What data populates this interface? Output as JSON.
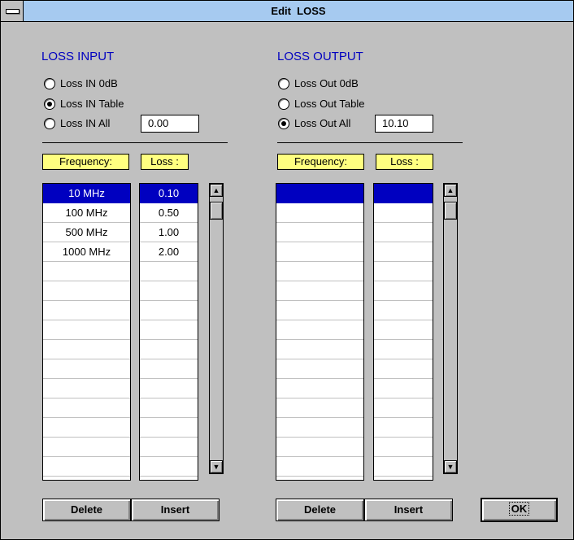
{
  "window": {
    "title": "Edit  LOSS"
  },
  "input": {
    "section_title": "LOSS INPUT",
    "radios": [
      {
        "label": "Loss IN 0dB",
        "checked": false
      },
      {
        "label": "Loss IN Table",
        "checked": true
      },
      {
        "label": "Loss IN All",
        "checked": false
      }
    ],
    "all_value": "0.00",
    "freq_header": "Frequency:",
    "loss_header": "Loss :",
    "rows": [
      {
        "freq": "10 MHz",
        "loss": "0.10",
        "selected": true
      },
      {
        "freq": "100 MHz",
        "loss": "0.50",
        "selected": false
      },
      {
        "freq": "500 MHz",
        "loss": "1.00",
        "selected": false
      },
      {
        "freq": "1000 MHz",
        "loss": "2.00",
        "selected": false
      }
    ],
    "delete_label": "Delete",
    "insert_label": "Insert"
  },
  "output": {
    "section_title": "LOSS OUTPUT",
    "radios": [
      {
        "label": "Loss Out 0dB",
        "checked": false
      },
      {
        "label": "Loss Out Table",
        "checked": false
      },
      {
        "label": "Loss Out All",
        "checked": true
      }
    ],
    "all_value": "10.10",
    "freq_header": "Frequency:",
    "loss_header": "Loss :",
    "rows": [
      {
        "freq": "",
        "loss": "",
        "selected": true
      }
    ],
    "delete_label": "Delete",
    "insert_label": "Insert"
  },
  "ok_label": "OK",
  "icons": {
    "system_menu": "system-menu-icon",
    "scroll_up": "arrow-up-icon",
    "scroll_down": "arrow-down-icon"
  },
  "colors": {
    "titlebar": "#a6caf0",
    "section_title": "#0000c0",
    "selection": "#0000c0",
    "header_bg": "#ffff80",
    "window_bg": "#c0c0c0"
  }
}
